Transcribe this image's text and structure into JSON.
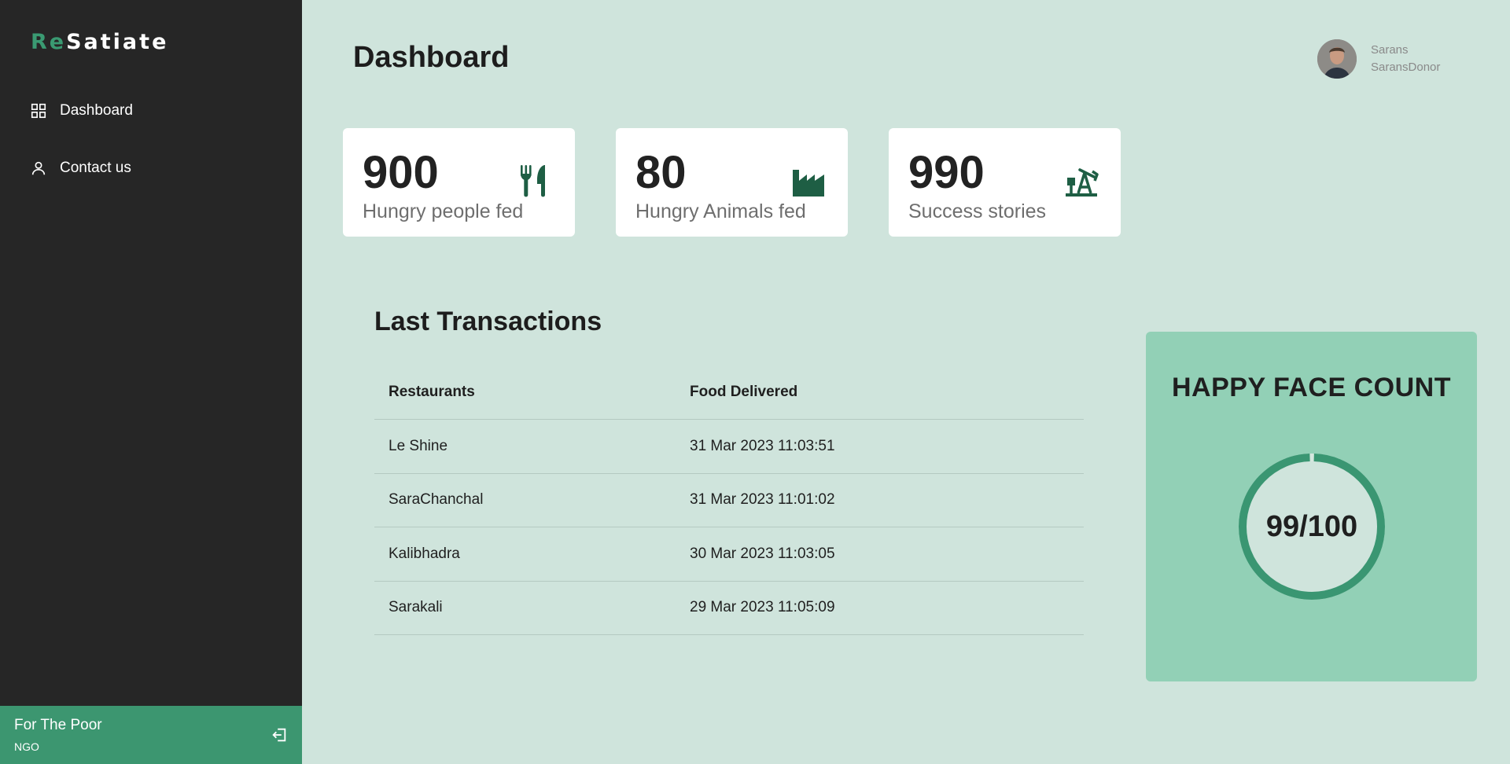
{
  "brand": {
    "prefix": "Re",
    "rest": "Satiate"
  },
  "nav": [
    {
      "label": "Dashboard",
      "icon": "grid-icon"
    },
    {
      "label": "Contact us",
      "icon": "user-icon"
    }
  ],
  "org": {
    "name": "For The Poor",
    "type": "NGO"
  },
  "header": {
    "title": "Dashboard"
  },
  "user": {
    "name": "Sarans",
    "role": "SaransDonor"
  },
  "stats": [
    {
      "value": "900",
      "label": "Hungry people fed",
      "icon": "utensils-icon"
    },
    {
      "value": "80",
      "label": "Hungry Animals fed",
      "icon": "industry-icon"
    },
    {
      "value": "990",
      "label": "Success stories",
      "icon": "oil-pump-icon"
    }
  ],
  "transactions": {
    "title": "Last Transactions",
    "columns": [
      "Restaurants",
      "Food Delivered"
    ],
    "rows": [
      [
        "Le Shine",
        "31 Mar 2023 11:03:51"
      ],
      [
        "SaraChanchal",
        "31 Mar 2023 11:01:02"
      ],
      [
        "Kalibhadra",
        "30 Mar 2023 11:03:05"
      ],
      [
        "Sarakali",
        "29 Mar 2023 11:05:09"
      ]
    ]
  },
  "happy": {
    "title": "HAPPY FACE COUNT",
    "value": 99,
    "max": 100,
    "display": "99/100"
  },
  "colors": {
    "sidebar": "#262626",
    "accent": "#3c9670",
    "background": "#cfe4dc",
    "panel": "#92d0b6",
    "icon": "#1e5e44"
  }
}
